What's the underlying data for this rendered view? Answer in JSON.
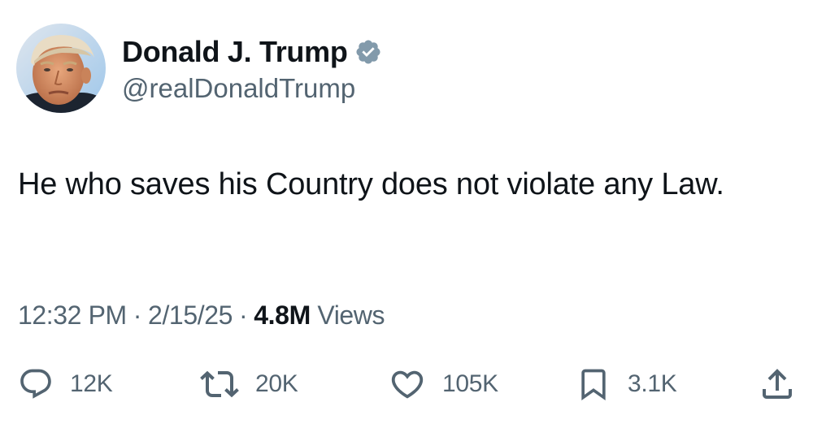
{
  "author": {
    "display_name": "Donald J. Trump",
    "handle": "@realDonaldTrump",
    "verified": true
  },
  "tweet": {
    "text": "He who saves his Country does not violate any Law."
  },
  "meta": {
    "time": "12:32 PM",
    "separator": "·",
    "date": "2/15/25",
    "views_count": "4.8M",
    "views_label": "Views"
  },
  "actions": {
    "replies": {
      "icon": "reply-icon",
      "count": "12K"
    },
    "reposts": {
      "icon": "repost-icon",
      "count": "20K"
    },
    "likes": {
      "icon": "heart-icon",
      "count": "105K"
    },
    "bookmarks": {
      "icon": "bookmark-icon",
      "count": "3.1K"
    },
    "share": {
      "icon": "share-icon"
    }
  },
  "colors": {
    "text_primary": "#0f1419",
    "text_secondary": "#536471",
    "verified_badge": "#829aab",
    "background": "#ffffff"
  }
}
